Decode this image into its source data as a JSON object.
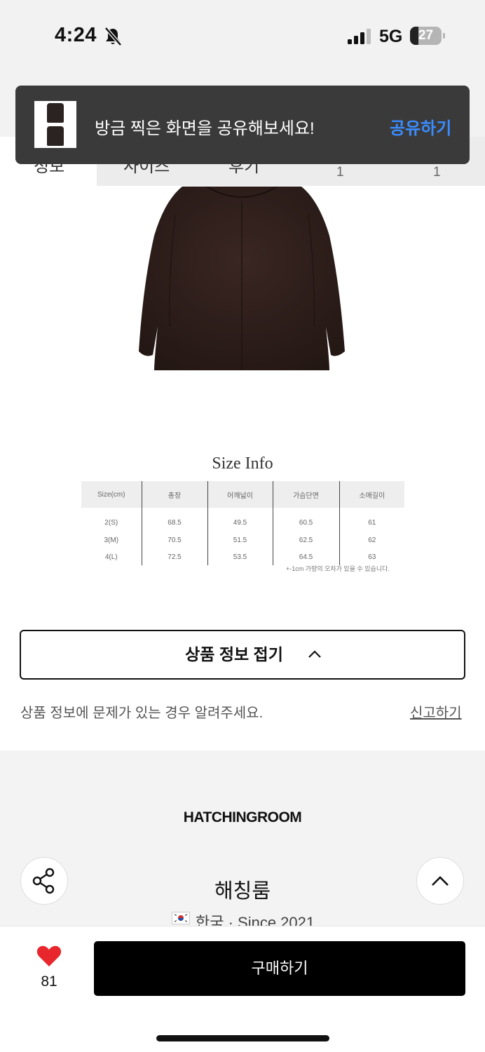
{
  "status_bar": {
    "time": "4:24",
    "network": "5G",
    "battery_percent": "27",
    "battery_level": 0.27
  },
  "tabs": [
    {
      "label": "정보",
      "count": ""
    },
    {
      "label": "사이즈",
      "count": ""
    },
    {
      "label": "후기",
      "count": "1"
    },
    {
      "label": "",
      "count": "1"
    }
  ],
  "toast": {
    "message": "방금 찍은 화면을 공유해보세요!",
    "action": "공유하기"
  },
  "size_info": {
    "title": "Size Info",
    "headers": [
      "Size(cm)",
      "총장",
      "어깨넓이",
      "가슴단면",
      "소매길이"
    ],
    "rows": [
      [
        "2(S)",
        "68.5",
        "49.5",
        "60.5",
        "61"
      ],
      [
        "3(M)",
        "70.5",
        "51.5",
        "62.5",
        "62"
      ],
      [
        "4(L)",
        "72.5",
        "53.5",
        "64.5",
        "63"
      ]
    ],
    "note": "+-1cm 가량의 오차가 있을 수 있습니다."
  },
  "collapse_button": {
    "label": "상품 정보 접기"
  },
  "report": {
    "text": "상품 정보에 문제가 있는 경우 알려주세요.",
    "link": "신고하기"
  },
  "brand": {
    "logo": "HATCHINGROOM",
    "name": "해칭룸",
    "meta": "한국 · Since 2021"
  },
  "bottom_bar": {
    "like_count": "81",
    "buy_label": "구매하기"
  },
  "colors": {
    "accent_blue": "#3a8cff",
    "heart_red": "#e8272d",
    "buy_button": "#000000"
  }
}
